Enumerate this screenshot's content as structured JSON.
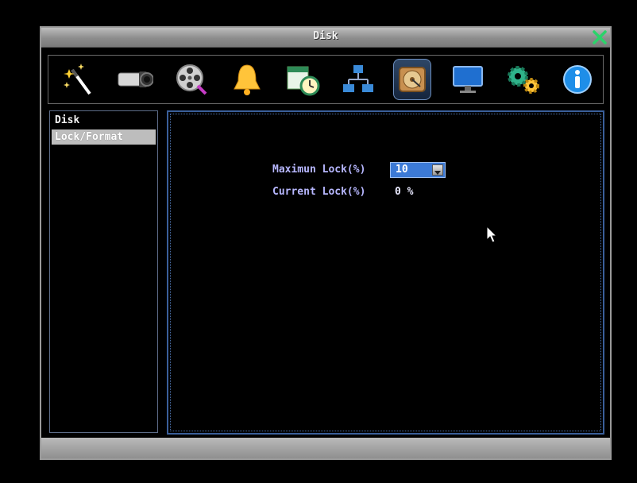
{
  "window": {
    "title": "Disk"
  },
  "toolbar": {
    "tools": [
      {
        "name": "quick-setup",
        "icon": "magic-wand-icon"
      },
      {
        "name": "camera",
        "icon": "camera-icon"
      },
      {
        "name": "record",
        "icon": "film-reel-icon"
      },
      {
        "name": "alarm",
        "icon": "bell-icon"
      },
      {
        "name": "schedule",
        "icon": "calendar-clock-icon"
      },
      {
        "name": "network",
        "icon": "network-icon"
      },
      {
        "name": "disk",
        "icon": "hard-disk-icon",
        "active": true
      },
      {
        "name": "display",
        "icon": "monitor-icon"
      },
      {
        "name": "system",
        "icon": "gears-icon"
      },
      {
        "name": "info",
        "icon": "info-icon"
      }
    ]
  },
  "sidebar": {
    "items": [
      {
        "label": "Disk",
        "selected": false
      },
      {
        "label": "Lock/Format",
        "selected": true
      }
    ]
  },
  "main": {
    "max_lock_label": "Maximun Lock(%)",
    "max_lock_value": "10",
    "current_lock_label": "Current Lock(%)",
    "current_lock_value": "0 %"
  },
  "colors": {
    "label": "#b7b7ff",
    "select_bg": "#3c7ad6",
    "active_tool": "#2e4666",
    "sidebar_selected": "#bdbdbd"
  }
}
